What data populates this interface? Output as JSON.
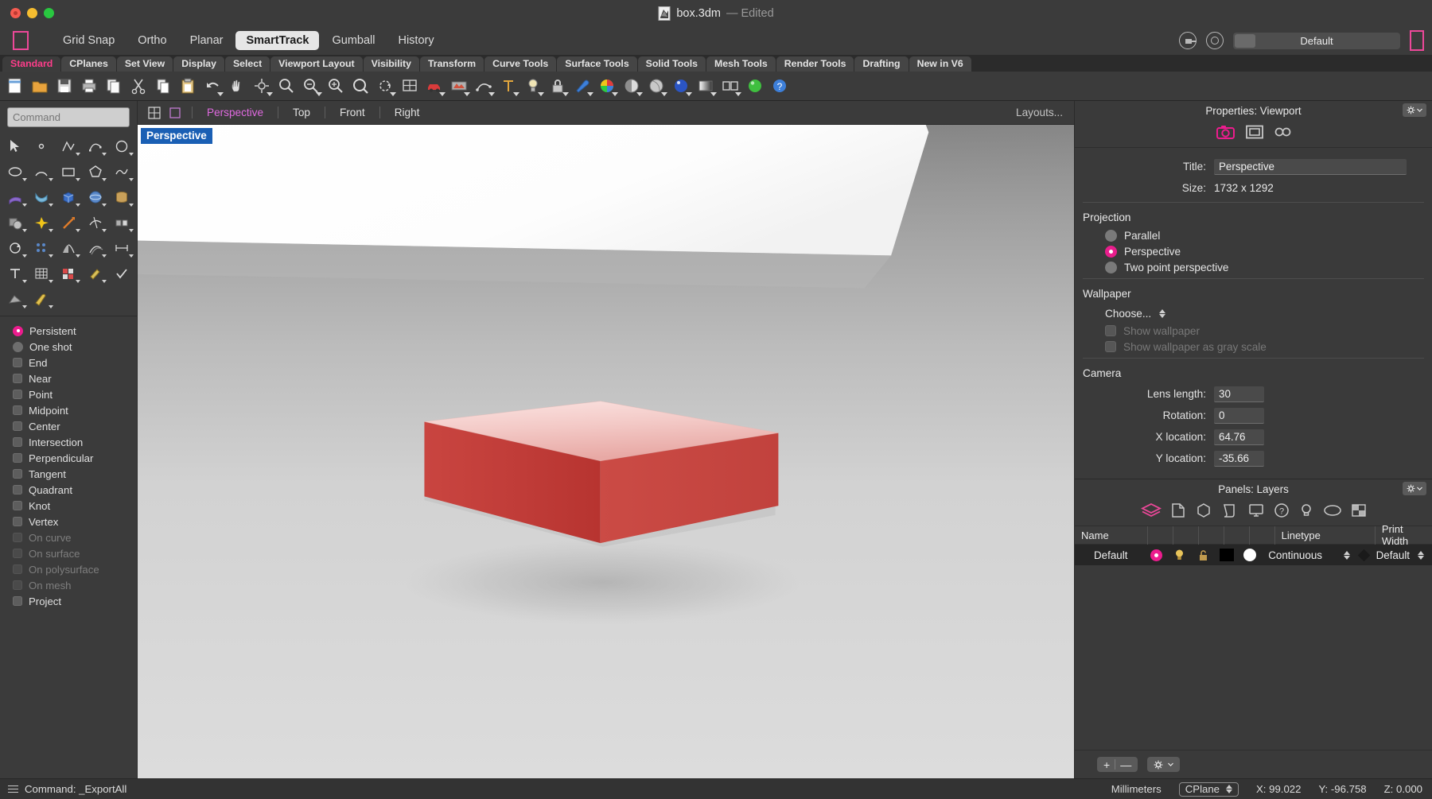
{
  "titlebar": {
    "document_name": "box.3dm",
    "edited_label": "— Edited",
    "doc_icon": "rhino-document-icon"
  },
  "modebar": {
    "modes": [
      {
        "label": "Grid Snap",
        "active": false
      },
      {
        "label": "Ortho",
        "active": false
      },
      {
        "label": "Planar",
        "active": false
      },
      {
        "label": "SmartTrack",
        "active": true
      },
      {
        "label": "Gumball",
        "active": false
      },
      {
        "label": "History",
        "active": false
      }
    ],
    "preset_label": "Default"
  },
  "tabs": [
    {
      "label": "Standard",
      "active": true
    },
    {
      "label": "CPlanes",
      "active": false
    },
    {
      "label": "Set View",
      "active": false
    },
    {
      "label": "Display",
      "active": false
    },
    {
      "label": "Select",
      "active": false
    },
    {
      "label": "Viewport Layout",
      "active": false
    },
    {
      "label": "Visibility",
      "active": false
    },
    {
      "label": "Transform",
      "active": false
    },
    {
      "label": "Curve Tools",
      "active": false
    },
    {
      "label": "Surface Tools",
      "active": false
    },
    {
      "label": "Solid Tools",
      "active": false
    },
    {
      "label": "Mesh Tools",
      "active": false
    },
    {
      "label": "Render Tools",
      "active": false
    },
    {
      "label": "Drafting",
      "active": false
    },
    {
      "label": "New in V6",
      "active": false
    }
  ],
  "command": {
    "placeholder": "Command",
    "value": ""
  },
  "osnap": {
    "modes": [
      {
        "label": "Persistent",
        "type": "radio",
        "on": true,
        "dim": false
      },
      {
        "label": "One shot",
        "type": "radio",
        "on": false,
        "dim": false
      }
    ],
    "snaps": [
      {
        "label": "End",
        "checked": false,
        "dim": false
      },
      {
        "label": "Near",
        "checked": false,
        "dim": false
      },
      {
        "label": "Point",
        "checked": false,
        "dim": false
      },
      {
        "label": "Midpoint",
        "checked": false,
        "dim": false
      },
      {
        "label": "Center",
        "checked": false,
        "dim": false
      },
      {
        "label": "Intersection",
        "checked": false,
        "dim": false
      },
      {
        "label": "Perpendicular",
        "checked": false,
        "dim": false
      },
      {
        "label": "Tangent",
        "checked": false,
        "dim": false
      },
      {
        "label": "Quadrant",
        "checked": false,
        "dim": false
      },
      {
        "label": "Knot",
        "checked": false,
        "dim": false
      },
      {
        "label": "Vertex",
        "checked": false,
        "dim": false
      },
      {
        "label": "On curve",
        "checked": false,
        "dim": true
      },
      {
        "label": "On surface",
        "checked": false,
        "dim": true
      },
      {
        "label": "On polysurface",
        "checked": false,
        "dim": true
      },
      {
        "label": "On mesh",
        "checked": false,
        "dim": true
      },
      {
        "label": "Project",
        "checked": false,
        "dim": false
      }
    ]
  },
  "viewport": {
    "tabs": [
      {
        "label": "Perspective",
        "active": true
      },
      {
        "label": "Top",
        "active": false
      },
      {
        "label": "Front",
        "active": false
      },
      {
        "label": "Right",
        "active": false
      }
    ],
    "layouts_label": "Layouts...",
    "active_label": "Perspective"
  },
  "properties": {
    "header": "Properties: Viewport",
    "title_label": "Title:",
    "title_value": "Perspective",
    "size_label": "Size:",
    "size_value": "1732 x 1292",
    "projection_header": "Projection",
    "projection_options": [
      {
        "label": "Parallel",
        "selected": false
      },
      {
        "label": "Perspective",
        "selected": true
      },
      {
        "label": "Two point perspective",
        "selected": false
      }
    ],
    "wallpaper_header": "Wallpaper",
    "wallpaper_choose": "Choose...",
    "wallpaper_checks": [
      {
        "label": "Show wallpaper",
        "checked": false
      },
      {
        "label": "Show wallpaper as gray scale",
        "checked": false
      }
    ],
    "camera_header": "Camera",
    "camera_fields": [
      {
        "label": "Lens length:",
        "value": "30"
      },
      {
        "label": "Rotation:",
        "value": "0"
      },
      {
        "label": "X location:",
        "value": "64.76"
      },
      {
        "label": "Y location:",
        "value": "-35.66"
      }
    ]
  },
  "layers": {
    "header": "Panels: Layers",
    "columns": [
      "Name",
      "Linetype",
      "Print Width"
    ],
    "rows": [
      {
        "name": "Default",
        "color_dot": "#ec1c8e",
        "linetype": "Continuous",
        "print_width": "Default"
      }
    ],
    "add_button": "+",
    "remove_button": "—"
  },
  "statusbar": {
    "command_text": "Command: _ExportAll",
    "units": "Millimeters",
    "cplane": "CPlane",
    "x": "X: 99.022",
    "y": "Y: -96.758",
    "z": "Z: 0.000"
  },
  "colors": {
    "accent_pink": "#ec1c8e",
    "tab_active": "#ff3d8b",
    "viewport_active": "#e06ae0",
    "label_blue": "#1a5fb4",
    "box_red": "#c8403c"
  }
}
